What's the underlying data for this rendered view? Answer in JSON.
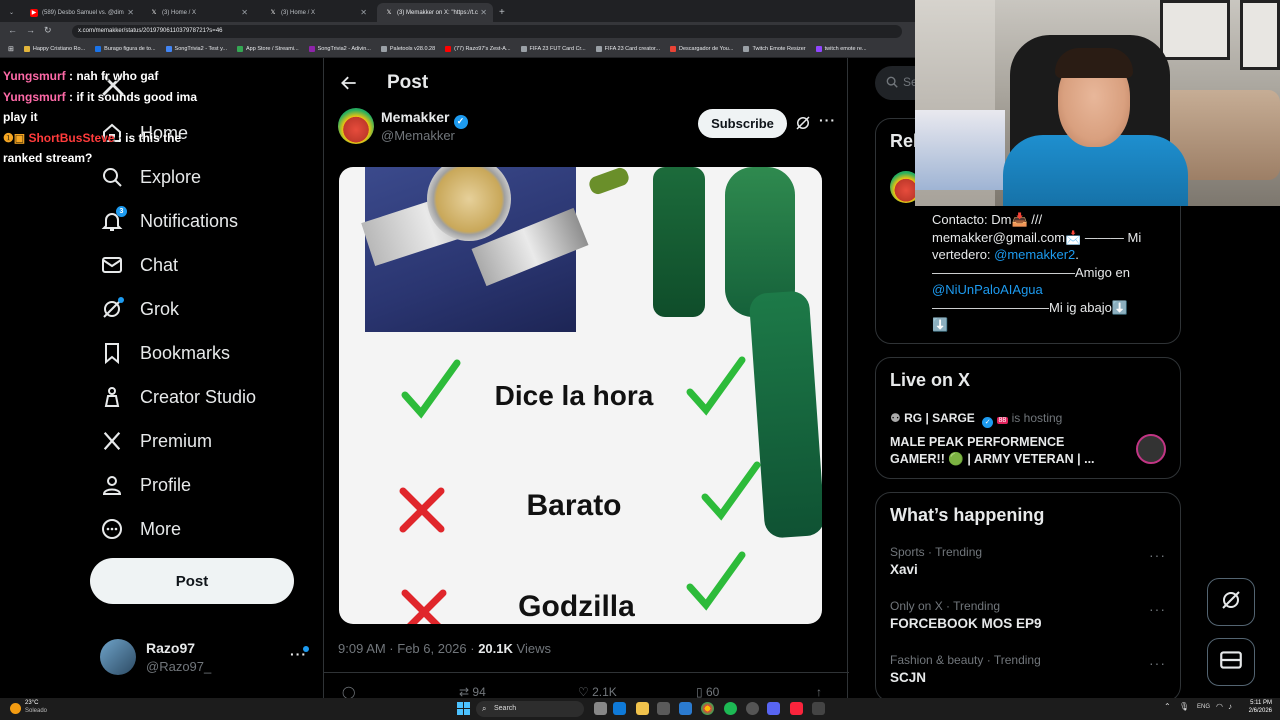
{
  "browser": {
    "tabs": [
      {
        "label": "(589) Desbo Samuel vs. @dim"
      },
      {
        "label": "(3) Home / X"
      },
      {
        "label": "(3) Home / X"
      },
      {
        "label": "(3) Memakker on X: \"https://t.c"
      }
    ],
    "url": "x.com/memakker/status/2019790611037978721?s=46",
    "bookmarks": [
      "Happy Cristiano Ro...",
      "Burago figura de to...",
      "SongTrivia2 - Test y...",
      "App Store / Streami...",
      "SongTrivia2 - Adivin...",
      "Paletools v28.0.28",
      "(77) Razo97's Zest-A...",
      "FIFA 23 FUT Card Cr...",
      "FIFA 23 Card creator...",
      "Descargador de You...",
      "Twitch Emote Resizer",
      "twitch emote re..."
    ]
  },
  "chat": [
    {
      "name": "Yungsmurf",
      "text": " : nah fr who gaf"
    },
    {
      "name": "Yungsmurf",
      "text": " : if it sounds good ima play it"
    },
    {
      "name": "ShortBusSteve",
      "text": " : is this the ranked stream?"
    }
  ],
  "nav": {
    "items": [
      {
        "label": "Home",
        "icon": "home-icon"
      },
      {
        "label": "Explore",
        "icon": "search-icon"
      },
      {
        "label": "Notifications",
        "icon": "bell-icon",
        "badge": "3"
      },
      {
        "label": "Chat",
        "icon": "mail-icon"
      },
      {
        "label": "Grok",
        "icon": "grok-icon"
      },
      {
        "label": "Bookmarks",
        "icon": "bookmark-icon"
      },
      {
        "label": "Creator Studio",
        "icon": "creator-studio-icon"
      },
      {
        "label": "Premium",
        "icon": "x-logo-icon"
      },
      {
        "label": "Profile",
        "icon": "person-icon"
      },
      {
        "label": "More",
        "icon": "more-circle-icon"
      }
    ],
    "post_button": "Post",
    "account": {
      "name": "Razo97",
      "handle": "@Razo97_"
    }
  },
  "post": {
    "header_title": "Post",
    "author_name": "Memakker",
    "author_handle": "@Memakker",
    "subscribe_label": "Subscribe",
    "meme_rows": [
      {
        "text": "Dice la hora",
        "left": "check",
        "right": "check"
      },
      {
        "text": "Barato",
        "left": "cross",
        "right": "check"
      },
      {
        "text": "Godzilla",
        "left": "cross",
        "right": "check"
      }
    ],
    "time": "9:09 AM · Feb 6, 2026 · ",
    "views_count": "20.1K",
    "views_label": " Views",
    "stats": {
      "replies": "",
      "reposts": "94",
      "likes": "2.1K",
      "bookmarks": "60"
    }
  },
  "right": {
    "search_placeholder": "Search",
    "relevant_title": "Relevant people",
    "bio_lines": [
      {
        "text": "Contacto: Dm📥 ///"
      },
      {
        "text": "memakker@gmail.com📩 ——— Mi"
      },
      {
        "text": "vertedero: ",
        "link": "@memakker2",
        "tail": "."
      },
      {
        "text": "———————————Amigo en"
      },
      {
        "link": "@NiUnPaloAIAgua"
      },
      {
        "text": "—————————Mi ig abajo⬇️"
      },
      {
        "text": "⬇️"
      }
    ],
    "live_title": "Live on X",
    "live_host": "RG | SARGE",
    "live_hosting": "is hosting",
    "live_tag": "88",
    "live_desc": "MALE PEAK PERFORMENCE GAMER!! 🟢 | ARMY VETERAN | ...",
    "happening_title": "What’s happening",
    "trends": [
      {
        "category": "Sports · Trending",
        "name": "Xavi"
      },
      {
        "category": "Only on X · Trending",
        "name": "FORCEBOOK MOS EP9"
      },
      {
        "category": "Fashion & beauty · Trending",
        "name": "SCJN"
      }
    ]
  },
  "taskbar": {
    "weather_temp": "23°C",
    "weather_desc": "Soleado",
    "search": "Search",
    "lang": "ENG",
    "time": "5:11 PM",
    "date": "2/6/2026"
  }
}
